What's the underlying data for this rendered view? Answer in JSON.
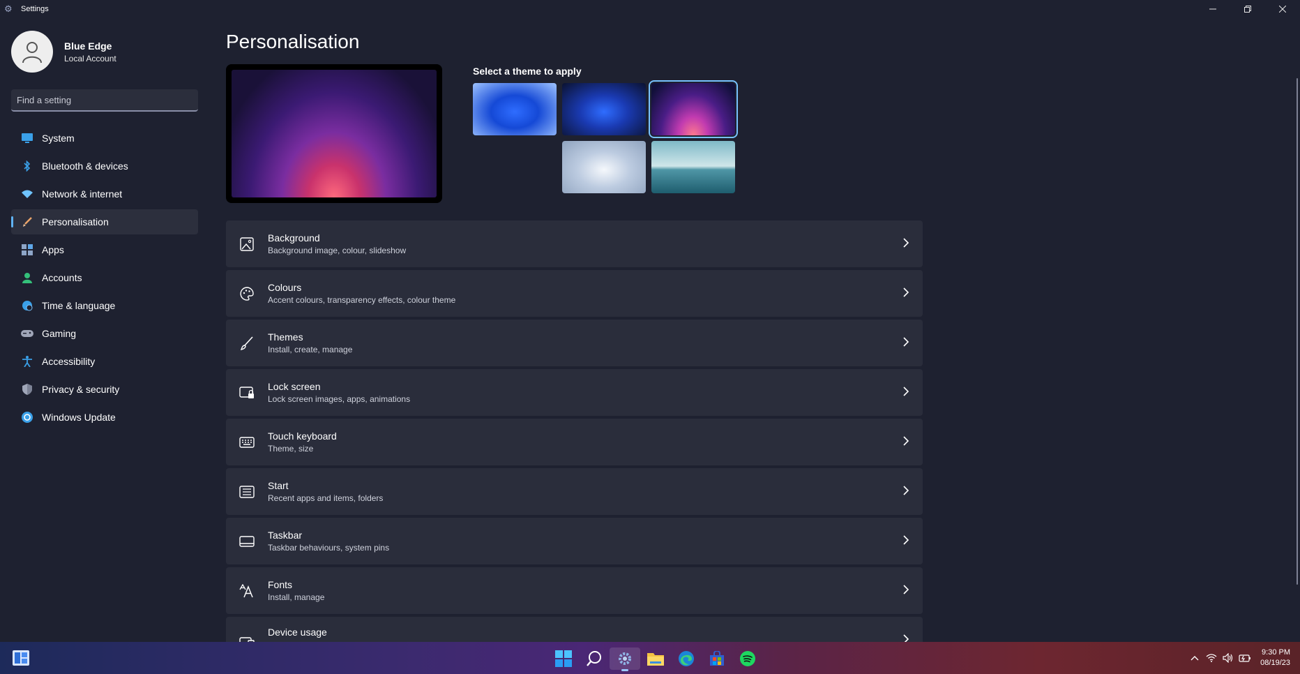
{
  "window": {
    "title": "Settings",
    "controls": [
      "minimize",
      "restore",
      "close"
    ]
  },
  "profile": {
    "name": "Blue Edge",
    "account_type": "Local Account"
  },
  "search": {
    "placeholder": "Find a setting"
  },
  "nav": {
    "items": [
      {
        "label": "System",
        "icon": "system-icon",
        "color": "#3aa0e8"
      },
      {
        "label": "Bluetooth & devices",
        "icon": "bluetooth-icon",
        "color": "#3aa0e8"
      },
      {
        "label": "Network & internet",
        "icon": "wifi-icon",
        "color": "#6fc3ff"
      },
      {
        "label": "Personalisation",
        "icon": "brush-icon",
        "color": "#e9a36a",
        "active": true
      },
      {
        "label": "Apps",
        "icon": "apps-icon",
        "color": "#8ea6c8"
      },
      {
        "label": "Accounts",
        "icon": "person-icon",
        "color": "#34c07a"
      },
      {
        "label": "Time & language",
        "icon": "globe-clock-icon",
        "color": "#3aa0e8"
      },
      {
        "label": "Gaming",
        "icon": "gamepad-icon",
        "color": "#a0a6b8"
      },
      {
        "label": "Accessibility",
        "icon": "accessibility-icon",
        "color": "#3aa0e8"
      },
      {
        "label": "Privacy & security",
        "icon": "shield-icon",
        "color": "#a0a6b8"
      },
      {
        "label": "Windows Update",
        "icon": "update-icon",
        "color": "#3aa0e8"
      }
    ]
  },
  "main": {
    "title": "Personalisation",
    "theme_heading": "Select a theme to apply",
    "themes": [
      {
        "name": "theme-light-bloom"
      },
      {
        "name": "theme-dark-bloom"
      },
      {
        "name": "theme-glow",
        "selected": true
      },
      {
        "name": "theme-captured-motion"
      },
      {
        "name": "theme-sunrise-lake"
      }
    ],
    "settings": [
      {
        "title": "Background",
        "subtitle": "Background image, colour, slideshow",
        "icon": "image-icon"
      },
      {
        "title": "Colours",
        "subtitle": "Accent colours, transparency effects, colour theme",
        "icon": "palette-icon"
      },
      {
        "title": "Themes",
        "subtitle": "Install, create, manage",
        "icon": "brush-icon"
      },
      {
        "title": "Lock screen",
        "subtitle": "Lock screen images, apps, animations",
        "icon": "lock-screen-icon"
      },
      {
        "title": "Touch keyboard",
        "subtitle": "Theme, size",
        "icon": "keyboard-icon"
      },
      {
        "title": "Start",
        "subtitle": "Recent apps and items, folders",
        "icon": "start-icon"
      },
      {
        "title": "Taskbar",
        "subtitle": "Taskbar behaviours, system pins",
        "icon": "taskbar-icon"
      },
      {
        "title": "Fonts",
        "subtitle": "Install, manage",
        "icon": "fonts-icon"
      },
      {
        "title": "Device usage",
        "subtitle": "",
        "icon": "device-usage-icon"
      }
    ]
  },
  "taskbar": {
    "apps": [
      "windows-start-icon",
      "search-icon",
      "settings-icon",
      "file-explorer-icon",
      "edge-icon",
      "store-icon",
      "spotify-icon"
    ],
    "tray": [
      "chevron-up-icon",
      "wifi-icon",
      "volume-icon",
      "battery-icon"
    ],
    "time": "9:30 PM",
    "date": "08/19/23"
  }
}
